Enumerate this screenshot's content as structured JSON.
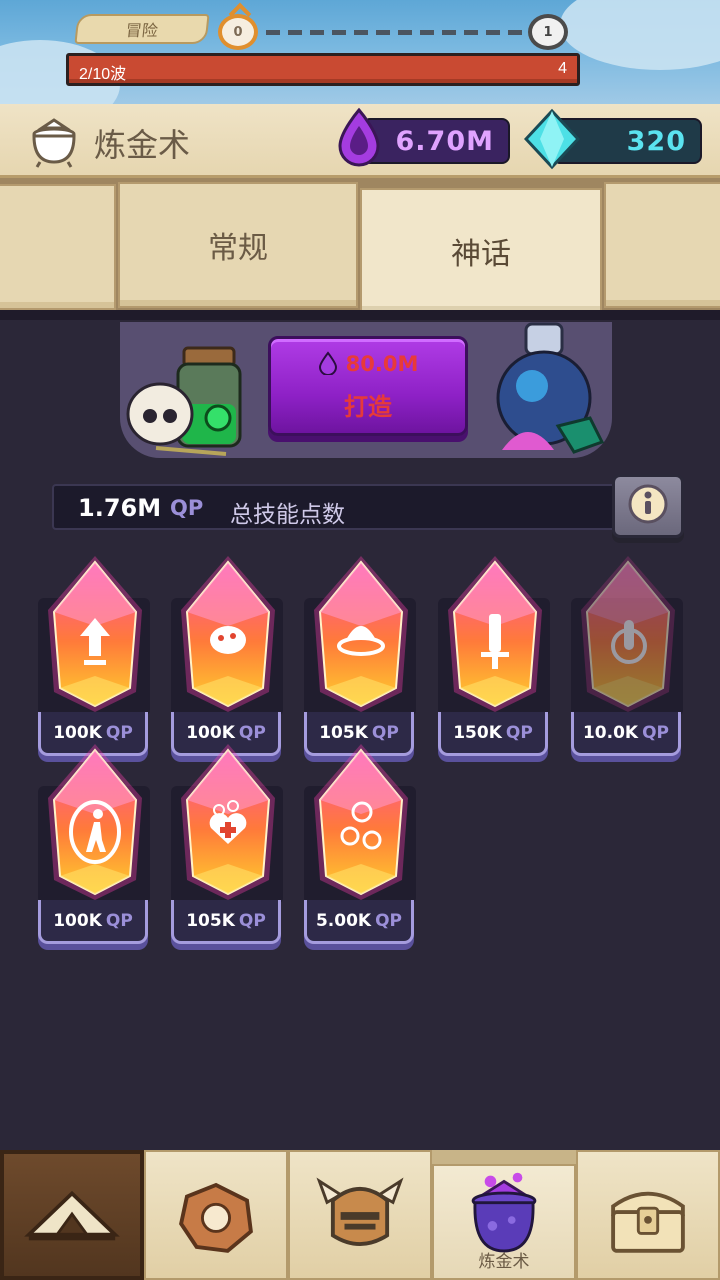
{
  "stage": {
    "label": "冒险",
    "current_node": "0",
    "next_node": "1",
    "wave_text": "2/10波",
    "wave_count": "4"
  },
  "header": {
    "title": "炼金术",
    "elixir_value": "6.70M",
    "gem_value": "320"
  },
  "tabs": [
    {
      "label": ""
    },
    {
      "label": "常规"
    },
    {
      "label": "神话"
    },
    {
      "label": ""
    }
  ],
  "craft": {
    "cost": "80.0M",
    "label": "打造"
  },
  "qp": {
    "value": "1.76M",
    "unit": "QP",
    "label": "总技能点数"
  },
  "gems": [
    {
      "price": "100K",
      "unit": "QP",
      "icon": "arrow-up-icon"
    },
    {
      "price": "100K",
      "unit": "QP",
      "icon": "shield-face-icon"
    },
    {
      "price": "105K",
      "unit": "QP",
      "icon": "helmet-ring-icon"
    },
    {
      "price": "150K",
      "unit": "QP",
      "icon": "sword-icon"
    },
    {
      "price": "10.0K",
      "unit": "QP",
      "icon": "finger-tap-icon"
    },
    {
      "price": "100K",
      "unit": "QP",
      "icon": "portal-walker-icon"
    },
    {
      "price": "105K",
      "unit": "QP",
      "icon": "heart-cross-icon"
    },
    {
      "price": "5.00K",
      "unit": "QP",
      "icon": "coins-icon"
    }
  ],
  "nav": {
    "alchemy_label": "炼金术"
  },
  "colors": {
    "gem_glow": "#ff3fb0",
    "gem_top": "#ff4fa8",
    "gem_bottom": "#ffcf2e",
    "price_border": "#a59cde",
    "craft_purple": "#9a2bd6"
  }
}
